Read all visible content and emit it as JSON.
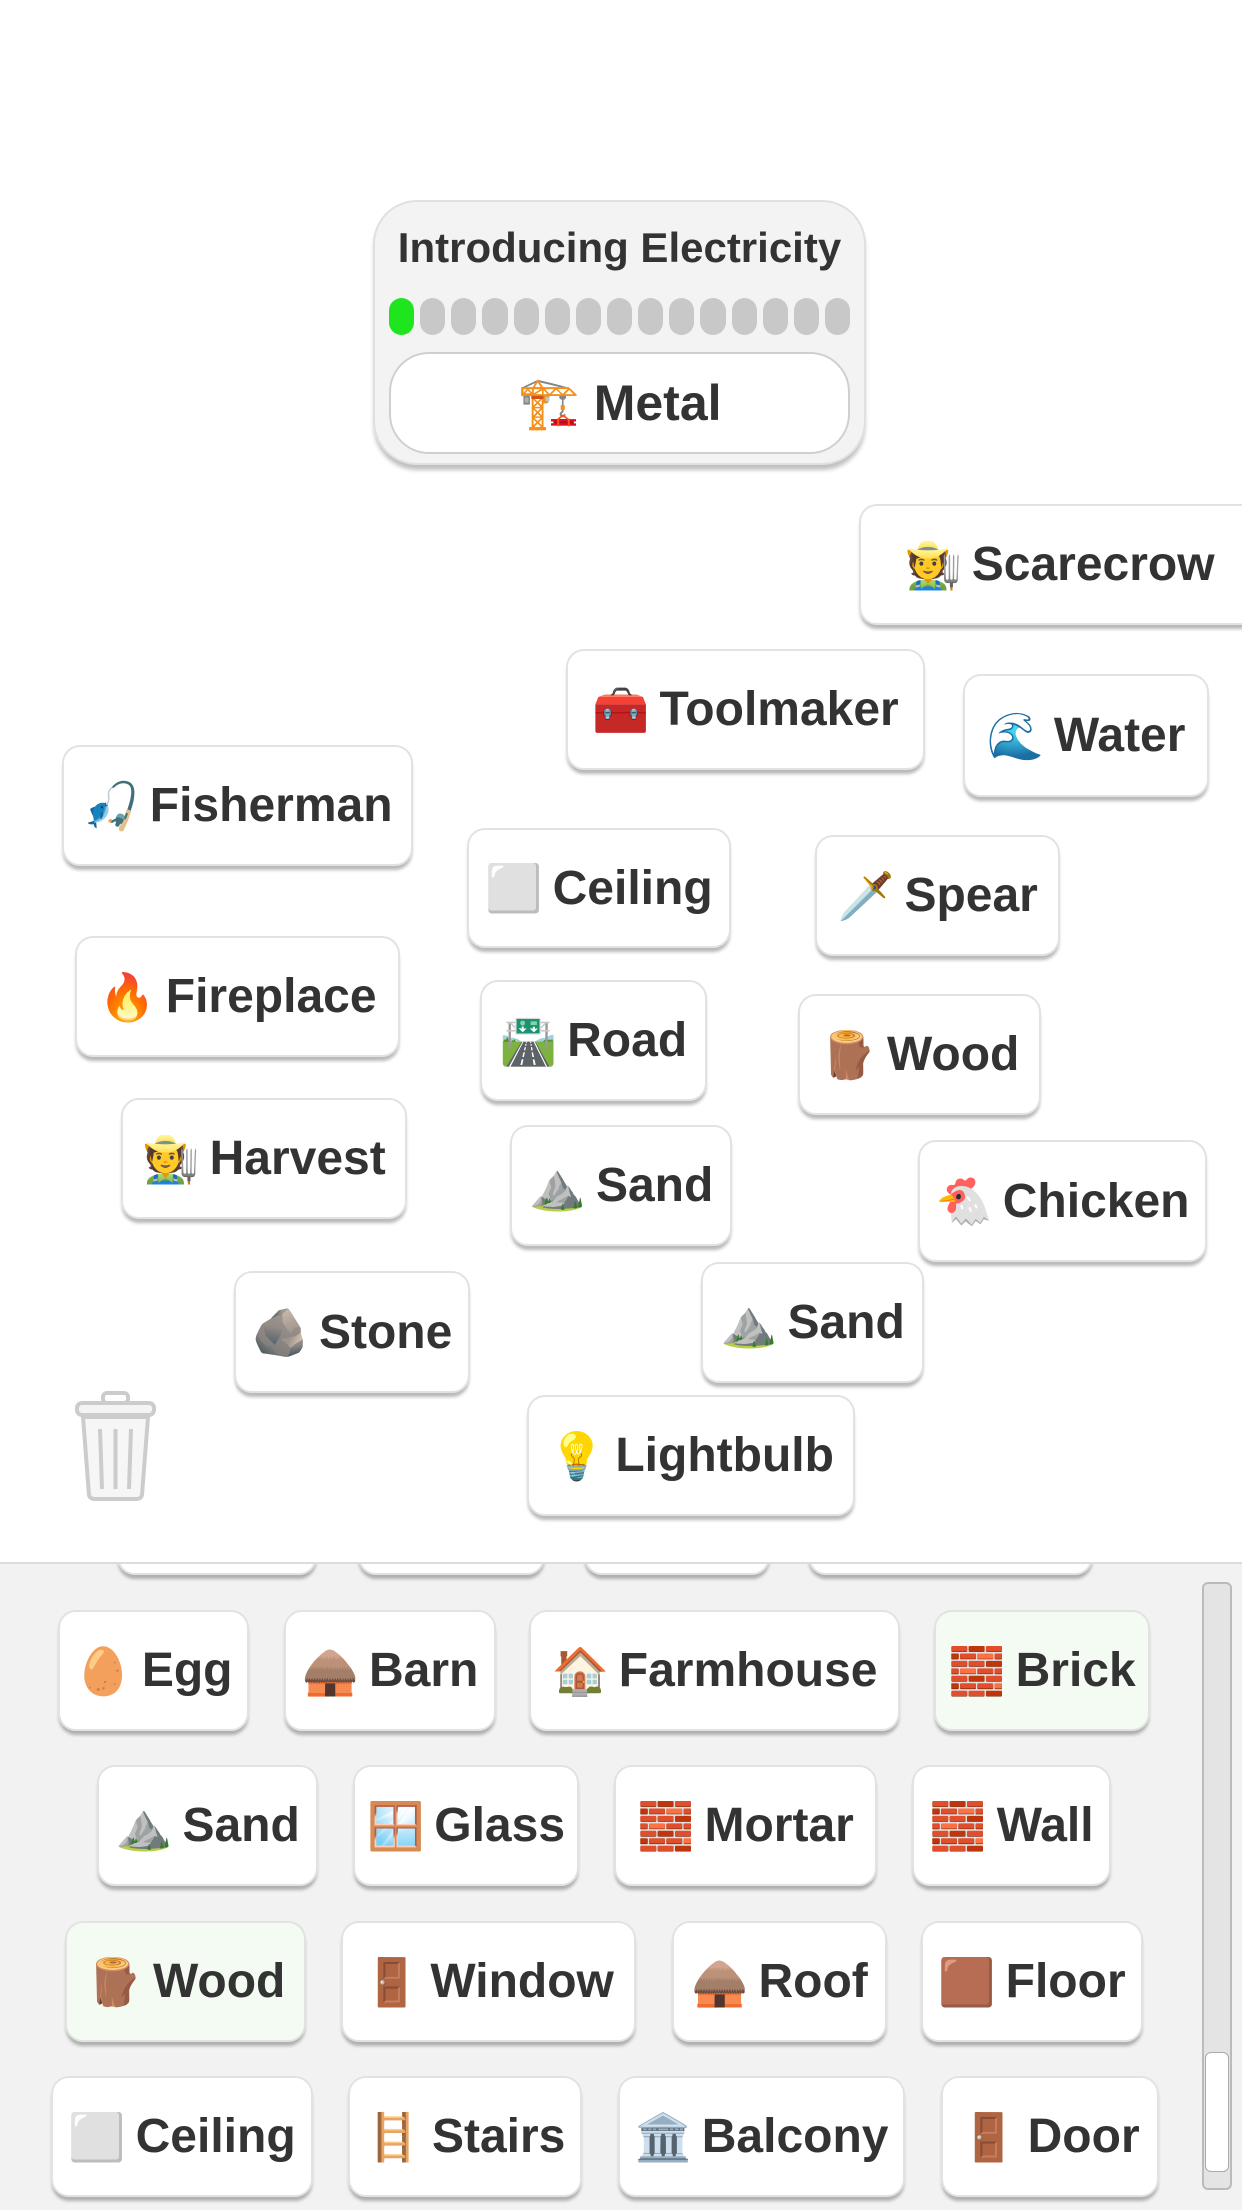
{
  "goal": {
    "title": "Introducing Electricity",
    "progress": {
      "completed": 1,
      "total": 15
    },
    "progress_color": "#1ee51e",
    "target": {
      "icon": "🏗️",
      "icon_name": "metal-beam-icon",
      "label": "Metal"
    }
  },
  "canvas": {
    "items": [
      {
        "icon": "🧑‍🌾",
        "icon_name": "scarecrow-icon",
        "label": "Scarecrow"
      },
      {
        "icon": "🧰",
        "icon_name": "toolbox-icon",
        "label": "Toolmaker"
      },
      {
        "icon": "🌊",
        "icon_name": "wave-icon",
        "label": "Water"
      },
      {
        "icon": "🎣",
        "icon_name": "fisherman-icon",
        "label": "Fisherman"
      },
      {
        "icon": "⬜",
        "icon_name": "ceiling-icon",
        "label": "Ceiling"
      },
      {
        "icon": "🗡️",
        "icon_name": "spear-icon",
        "label": "Spear"
      },
      {
        "icon": "🔥",
        "icon_name": "fireplace-icon",
        "label": "Fireplace"
      },
      {
        "icon": "🛣️",
        "icon_name": "road-icon",
        "label": "Road"
      },
      {
        "icon": "🪵",
        "icon_name": "wood-icon",
        "label": "Wood"
      },
      {
        "icon": "🧑‍🌾",
        "icon_name": "farmer-icon",
        "label": "Harvest"
      },
      {
        "icon": "⛰️",
        "icon_name": "sand-icon",
        "label": "Sand"
      },
      {
        "icon": "🐔",
        "icon_name": "chicken-icon",
        "label": "Chicken"
      },
      {
        "icon": "🪨",
        "icon_name": "rock-icon",
        "label": "Stone"
      },
      {
        "icon": "⛰️",
        "icon_name": "sand-icon",
        "label": "Sand"
      },
      {
        "icon": "💡",
        "icon_name": "lightbulb-icon",
        "label": "Lightbulb"
      }
    ]
  },
  "inventory": {
    "items": [
      {
        "icon": "",
        "icon_name": "",
        "label": ""
      },
      {
        "icon": "",
        "icon_name": "",
        "label": ""
      },
      {
        "icon": "",
        "icon_name": "",
        "label": ""
      },
      {
        "icon": "",
        "icon_name": "",
        "label": ""
      },
      {
        "icon": "🥚",
        "icon_name": "egg-icon",
        "label": "Egg"
      },
      {
        "icon": "🛖",
        "icon_name": "barn-icon",
        "label": "Barn"
      },
      {
        "icon": "🏠",
        "icon_name": "farmhouse-icon",
        "label": "Farmhouse"
      },
      {
        "icon": "🧱",
        "icon_name": "brick-icon",
        "label": "Brick",
        "highlight": true
      },
      {
        "icon": "⛰️",
        "icon_name": "sand-icon",
        "label": "Sand"
      },
      {
        "icon": "🪟",
        "icon_name": "glass-icon",
        "label": "Glass"
      },
      {
        "icon": "🧱",
        "icon_name": "mortar-icon",
        "label": "Mortar"
      },
      {
        "icon": "🧱",
        "icon_name": "wall-icon",
        "label": "Wall"
      },
      {
        "icon": "🪵",
        "icon_name": "wood-icon",
        "label": "Wood",
        "highlight": true
      },
      {
        "icon": "🚪",
        "icon_name": "window-icon",
        "label": "Window"
      },
      {
        "icon": "🛖",
        "icon_name": "hut-icon",
        "label": "Roof"
      },
      {
        "icon": "🟫",
        "icon_name": "parquet-icon",
        "label": "Floor"
      },
      {
        "icon": "⬜",
        "icon_name": "ceiling-icon",
        "label": "Ceiling"
      },
      {
        "icon": "🪜",
        "icon_name": "stairs-icon",
        "label": "Stairs"
      },
      {
        "icon": "🏛️",
        "icon_name": "balcony-icon",
        "label": "Balcony"
      },
      {
        "icon": "🚪",
        "icon_name": "door-icon",
        "label": "Door"
      }
    ],
    "highlight_color": "#f3fbf3"
  }
}
